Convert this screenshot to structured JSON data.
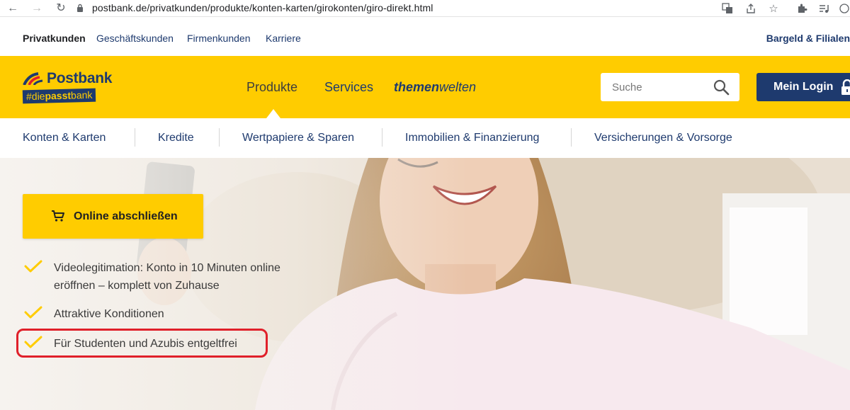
{
  "browser": {
    "url": "postbank.de/privatkunden/produkte/konten-karten/girokonten/giro-direkt.html"
  },
  "utility_nav": {
    "items": [
      {
        "label": "Privatkunden"
      },
      {
        "label": "Geschäftskunden"
      },
      {
        "label": "Firmenkunden"
      },
      {
        "label": "Karriere"
      }
    ],
    "right_link": "Bargeld & Filialen"
  },
  "header": {
    "logo_name": "Postbank",
    "logo_tag_prefix": "#die",
    "logo_tag_bold": "passt",
    "logo_tag_suffix": "bank",
    "main_nav": {
      "produkte": "Produkte",
      "services": "Services",
      "themen_bold": "themen",
      "themen_light": "welten"
    },
    "search_placeholder": "Suche",
    "login_label": "Mein Login"
  },
  "categories": [
    {
      "label": "Konten & Karten"
    },
    {
      "label": "Kredite"
    },
    {
      "label": "Wertpapiere & Sparen"
    },
    {
      "label": "Immobilien & Finanzierung"
    },
    {
      "label": "Versicherungen & Vorsorge"
    }
  ],
  "hero": {
    "cta_label": "Online abschließen",
    "features": [
      {
        "line1": "Videolegitimation: Konto in 10 Minuten online",
        "line2": "eröffnen – komplett von Zuhause"
      },
      {
        "line1": "Attraktive Konditionen"
      },
      {
        "line1": "Für Studenten und Azubis entgeltfrei"
      }
    ]
  },
  "colors": {
    "brand_yellow": "#ffcc00",
    "brand_blue": "#1e3a6e",
    "highlight_red": "#e0202a"
  }
}
